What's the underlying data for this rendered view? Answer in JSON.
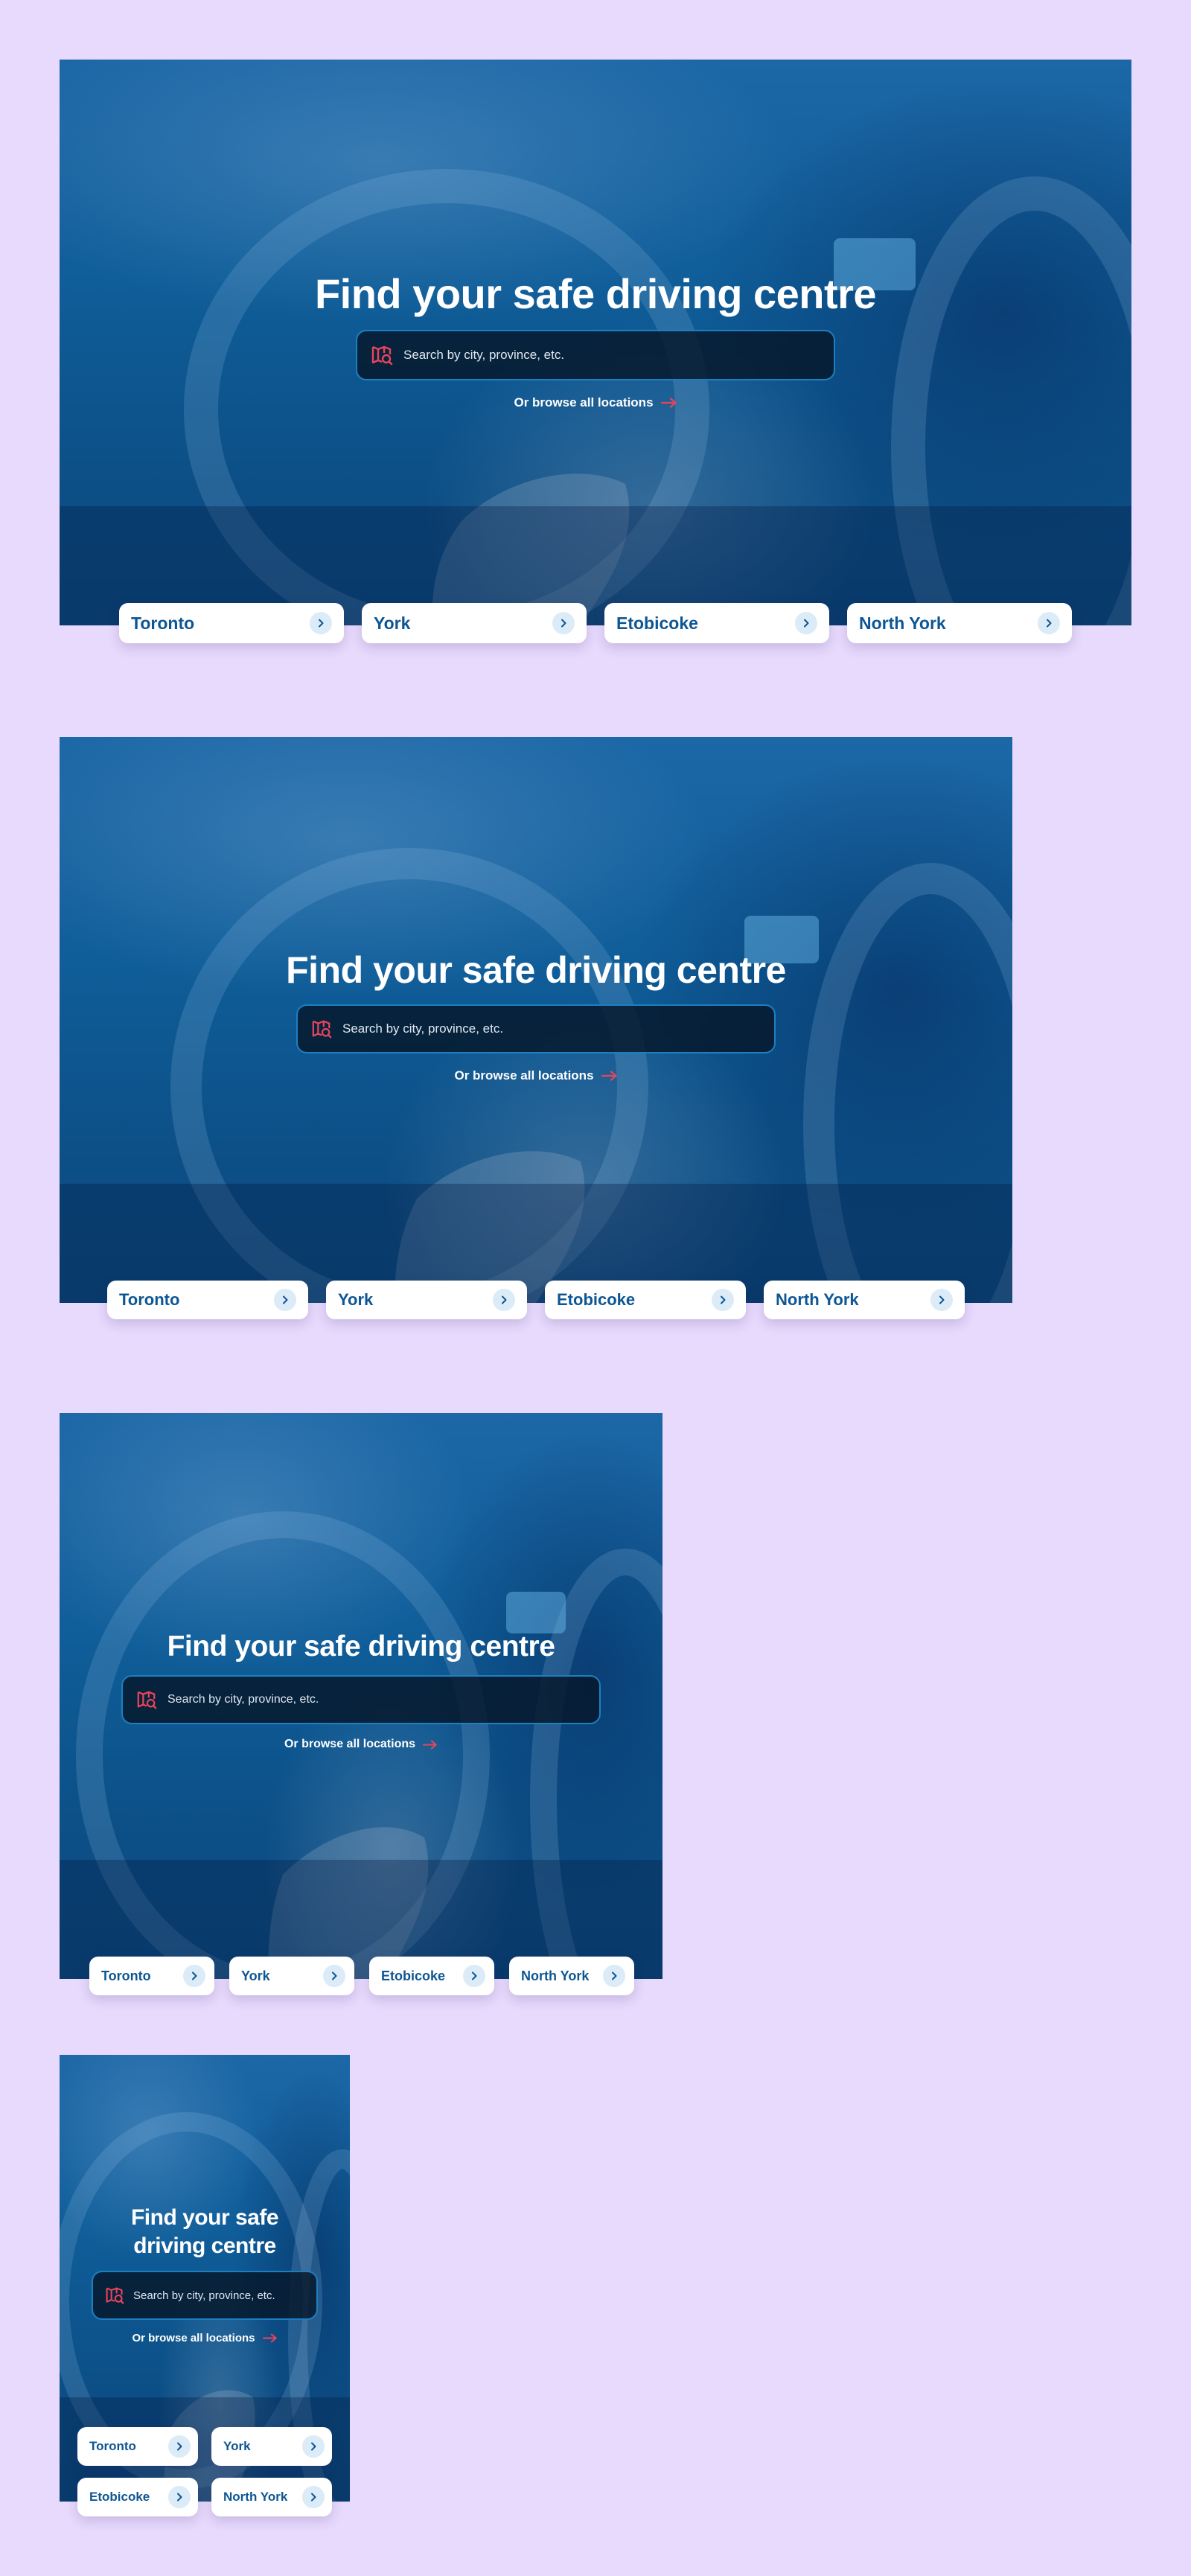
{
  "hero": {
    "title": "Find your safe driving centre",
    "title_line1": "Find your safe",
    "title_line2": "driving centre",
    "search_placeholder": "Search by city, province, etc.",
    "browse_label": "Or browse all locations",
    "search_icon": "map-search-icon",
    "arrow_icon": "arrow-right-icon",
    "chevron_icon": "chevron-right-icon"
  },
  "locations": [
    {
      "label": "Toronto"
    },
    {
      "label": "York"
    },
    {
      "label": "Etobicoke"
    },
    {
      "label": "North York"
    }
  ],
  "colors": {
    "page_background": "#e8dafd",
    "hero_blue": "#0f5d99",
    "card_text": "#0d5694",
    "accent": "#e8445c",
    "search_border": "#1e7fc0"
  }
}
